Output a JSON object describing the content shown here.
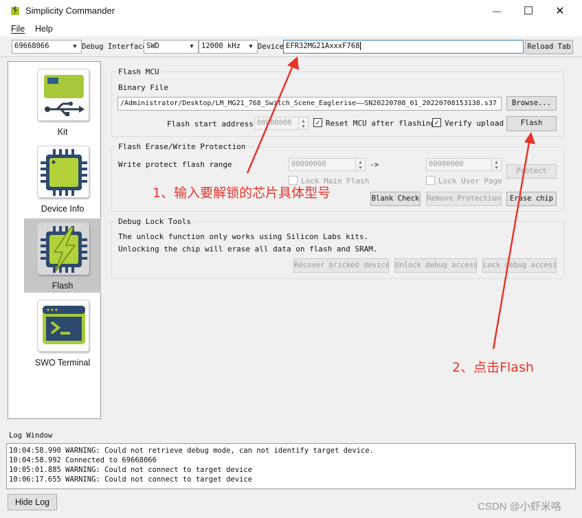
{
  "window": {
    "title": "Simplicity Commander",
    "minimize_glyph": "—",
    "maximize_glyph": "☐",
    "close_glyph": "✕"
  },
  "menu": {
    "file": "File",
    "help": "Help"
  },
  "toolbar": {
    "adapter_value": "69668066",
    "debug_interface_label": "Debug Interface",
    "debug_interface_value": "SWD",
    "speed_value": "12000 kHz",
    "device_label": "Device",
    "device_value": "EFR32MG21AxxxF768",
    "reload_tab_label": "Reload Tab"
  },
  "sidebar": {
    "items": [
      {
        "label": "Kit",
        "icon": "usb-kit-icon"
      },
      {
        "label": "Device Info",
        "icon": "chip-icon"
      },
      {
        "label": "Flash",
        "icon": "flash-chip-icon",
        "selected": true
      },
      {
        "label": "SWO Terminal",
        "icon": "terminal-icon"
      }
    ]
  },
  "flash_mcu": {
    "group_title": "Flash MCU",
    "binary_file_label": "Binary File",
    "binary_file_path": "/Administrator/Desktop/LM_MG21_768_Switch_Scene_Eaglerise——SN20220708_01_20220708153138.s37",
    "browse_label": "Browse...",
    "start_address_label": "Flash start address:",
    "start_address_value": "00000000",
    "reset_label": "Reset MCU after flashing",
    "verify_label": "Verify upload",
    "flash_label": "Flash"
  },
  "erase_write": {
    "group_title": "Flash Erase/Write Protection",
    "range_label": "Write protect flash range",
    "range_start": "00000000",
    "range_arrow": "->",
    "range_end": "00000000",
    "protect_label": "Protect",
    "lock_main_label": "Lock Main Flash",
    "lock_user_label": "Lock User Page",
    "blank_check_label": "Blank Check",
    "remove_protection_label": "Remove Protection",
    "erase_chip_label": "Erase chip"
  },
  "debug_lock": {
    "group_title": "Debug Lock Tools",
    "line1": "The unlock function only works using Silicon Labs kits.",
    "line2": "Unlocking the chip will erase all data on flash and SRAM.",
    "recover_label": "Recover bricked device",
    "unlock_label": "Unlock debug access",
    "lock_label": "Lock debug access"
  },
  "log": {
    "title": "Log Window",
    "lines": [
      "10:04:58.990 WARNING: Could not retrieve debug mode, can not identify target device.",
      "10:04:58.992 Connected to 69668066",
      "10:05:01.885 WARNING: Could not connect to target device",
      "10:06:17.655 WARNING: Could not connect to target device"
    ],
    "hide_log_label": "Hide Log"
  },
  "annotations": {
    "step1": "1、输入要解锁的芯片具体型号",
    "step2": "2、点击Flash",
    "color": "#e8342a"
  },
  "watermark": "CSDN @小虾米咯"
}
